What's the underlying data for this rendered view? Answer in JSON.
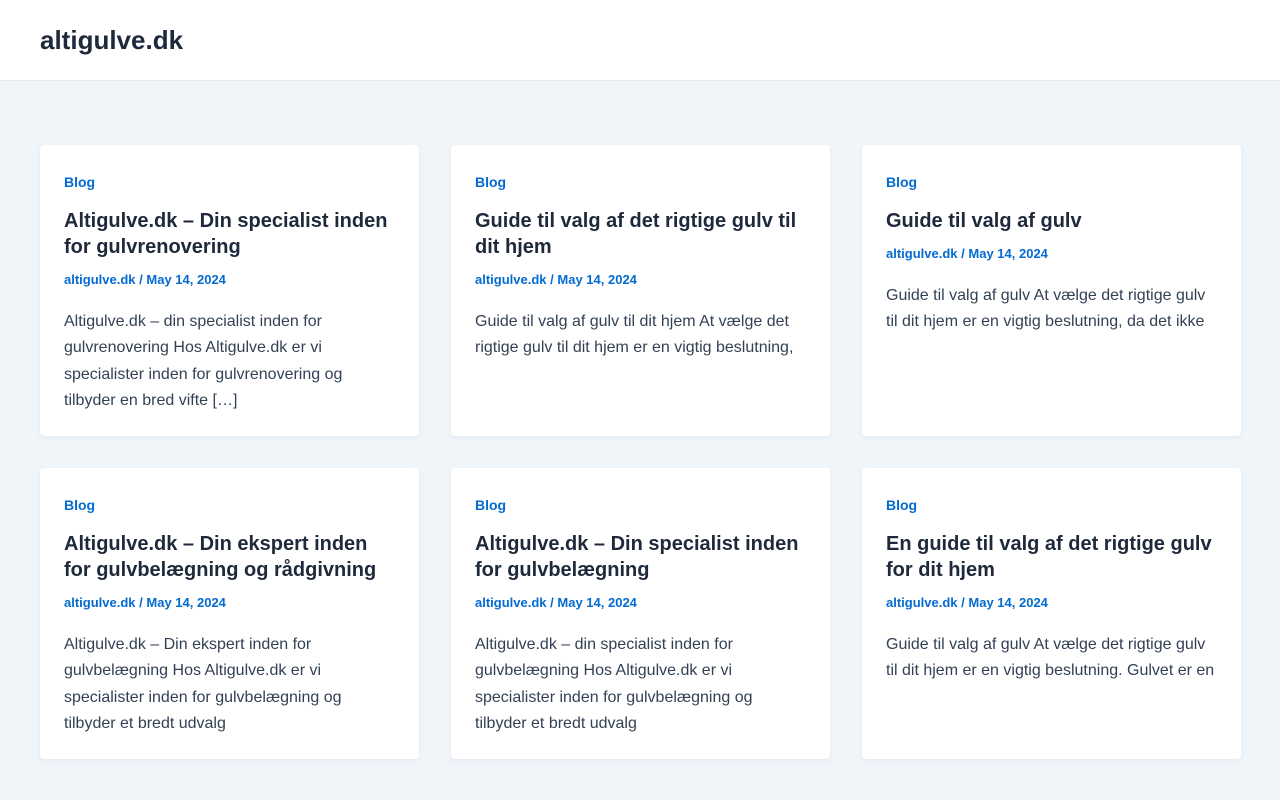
{
  "site": {
    "title": "altigulve.dk"
  },
  "posts": [
    {
      "category": "Blog",
      "title": "Altigulve.dk – Din specialist inden for gulvrenovering",
      "author": "altigulve.dk",
      "separator": "/",
      "date": "May 14, 2024",
      "excerpt": "Altigulve.dk – din specialist inden for gulvrenovering Hos Altigulve.dk er vi specialister inden for gulvrenovering og tilbyder en bred vifte […]"
    },
    {
      "category": "Blog",
      "title": "Guide til valg af det rigtige gulv til dit hjem",
      "author": "altigulve.dk",
      "separator": "/",
      "date": "May 14, 2024",
      "excerpt": "Guide til valg af gulv til dit hjem At vælge det rigtige gulv til dit hjem er en vigtig beslutning,"
    },
    {
      "category": "Blog",
      "title": "Guide til valg af gulv",
      "author": "altigulve.dk",
      "separator": "/",
      "date": "May 14, 2024",
      "excerpt": "Guide til valg af gulv At vælge det rigtige gulv til dit hjem er en vigtig beslutning, da det ikke"
    },
    {
      "category": "Blog",
      "title": "Altigulve.dk – Din ekspert inden for gulvbelægning og rådgivning",
      "author": "altigulve.dk",
      "separator": "/",
      "date": "May 14, 2024",
      "excerpt": "Altigulve.dk – Din ekspert inden for gulvbelægning Hos Altigulve.dk er vi specialister inden for gulvbelægning og tilbyder et bredt udvalg"
    },
    {
      "category": "Blog",
      "title": "Altigulve.dk – Din specialist inden for gulvbelægning",
      "author": "altigulve.dk",
      "separator": "/",
      "date": "May 14, 2024",
      "excerpt": "Altigulve.dk – din specialist inden for gulvbelægning Hos Altigulve.dk er vi specialister inden for gulvbelægning og tilbyder et bredt udvalg"
    },
    {
      "category": "Blog",
      "title": "En guide til valg af det rigtige gulv for dit hjem",
      "author": "altigulve.dk",
      "separator": "/",
      "date": "May 14, 2024",
      "excerpt": "Guide til valg af gulv At vælge det rigtige gulv til dit hjem er en vigtig beslutning. Gulvet er en"
    }
  ],
  "colors": {
    "accent": "#046bd2",
    "heading": "#1e293b",
    "body_text": "#334155",
    "page_bg": "#f0f5fa",
    "card_bg": "#ffffff"
  }
}
